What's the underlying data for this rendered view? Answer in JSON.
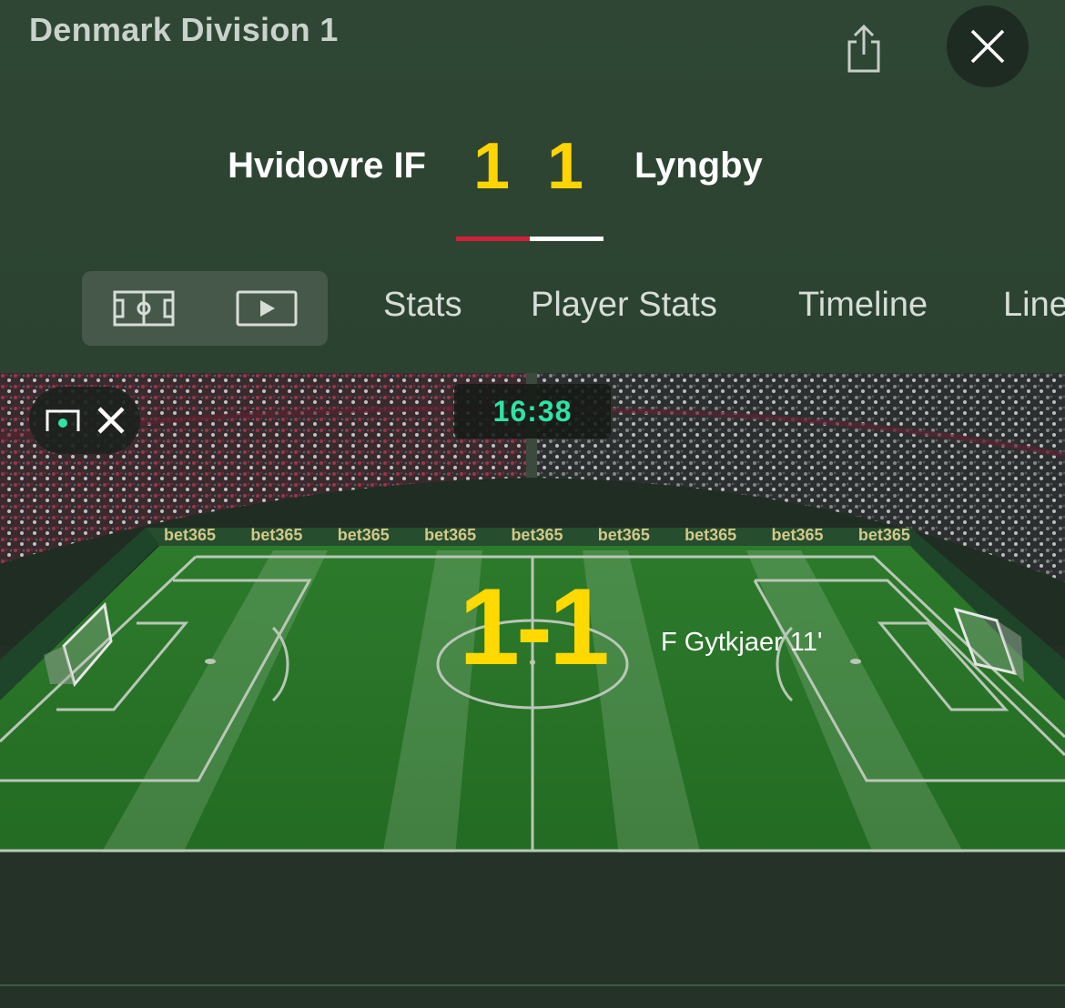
{
  "header": {
    "league": "Denmark Division 1",
    "share_icon": "share-icon",
    "close_icon": "close-icon"
  },
  "match": {
    "home_team": "Hvidovre IF",
    "away_team": "Lyngby",
    "home_score": "1",
    "away_score": "1",
    "home_color": "#d2203a",
    "away_color": "#ffffff",
    "score_color": "#ffd400"
  },
  "tabs": {
    "view_icons": [
      "pitch-view-icon",
      "video-play-icon"
    ],
    "items": [
      "Stats",
      "Player Stats",
      "Timeline",
      "Line"
    ]
  },
  "live": {
    "clock": "16:38",
    "clock_color": "#2fe3a4",
    "goal_score": "1-1",
    "scorer": "F Gytkjaer 11'",
    "sponsor": "bet365"
  }
}
